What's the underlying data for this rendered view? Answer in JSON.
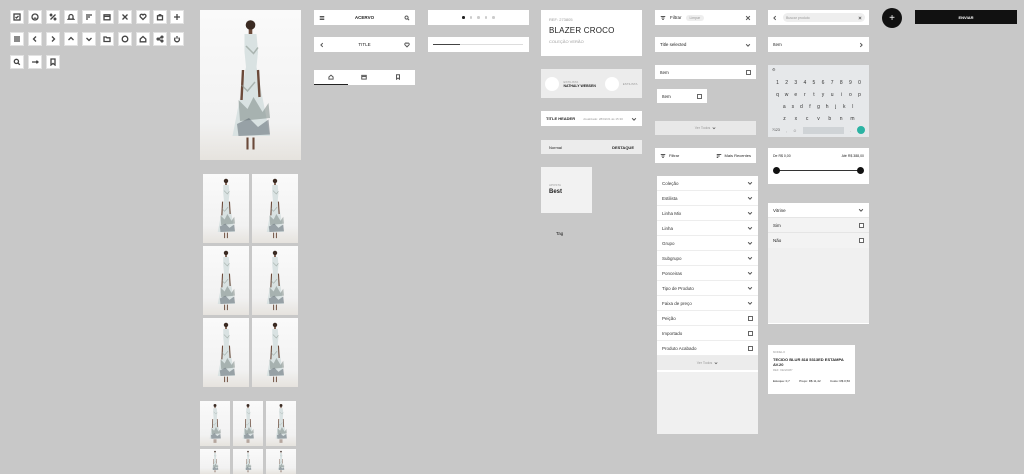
{
  "header": {
    "search_label": "ACERVO",
    "title": "TITLE"
  },
  "tabs": [
    "home",
    "calendar",
    "bookmark"
  ],
  "pagination": {
    "count": 5,
    "active": 0,
    "progress": 0.3
  },
  "product": {
    "ref": "REF: 273805",
    "name": "BLAZER CROCO",
    "collection": "COLEÇÃO VERÃO"
  },
  "designers": [
    {
      "label": "ESTILISTA",
      "name": "NATHALY WEBSEN"
    },
    {
      "label": "ESTILISTA",
      "name": ""
    }
  ],
  "title_header": {
    "label": "TITLE HEADER",
    "updated": "Atualizado: 28/02/21 às 15:30"
  },
  "toggle": {
    "left": "Normal",
    "right": "DESTAQUE"
  },
  "highlight": {
    "label": "APOSTA",
    "value": "Best"
  },
  "tag": "Tag",
  "filter_chip": {
    "label": "Filtrar",
    "chip": "Limpar"
  },
  "select": {
    "value": "Title selected"
  },
  "item_list": {
    "item_label": "Item",
    "item2_label": "Item",
    "see_all": "Ver Todos"
  },
  "sortbar": {
    "filter": "Filtrar",
    "sort": "Mais Recentes"
  },
  "filters": [
    {
      "label": "Coleção",
      "type": "chevron"
    },
    {
      "label": "Estilista",
      "type": "chevron"
    },
    {
      "label": "Linha Mix",
      "type": "chevron"
    },
    {
      "label": "Linha",
      "type": "chevron"
    },
    {
      "label": "Grupo",
      "type": "chevron"
    },
    {
      "label": "Subgrupo",
      "type": "chevron"
    },
    {
      "label": "Ponceiras",
      "type": "chevron"
    },
    {
      "label": "Tipo de Produto",
      "type": "chevron"
    },
    {
      "label": "Faixa de preço",
      "type": "chevron"
    },
    {
      "label": "Peição",
      "type": "check"
    },
    {
      "label": "Importado",
      "type": "check"
    },
    {
      "label": "Produto Acabado",
      "type": "check"
    }
  ],
  "filters_see_all": "Ver Todos",
  "search": {
    "placeholder": "Buscar produto"
  },
  "item_dropdown": {
    "label": "Item"
  },
  "keyboard": {
    "row1": [
      "1",
      "2",
      "3",
      "4",
      "5",
      "6",
      "7",
      "8",
      "9",
      "0"
    ],
    "row2": [
      "q",
      "w",
      "e",
      "r",
      "t",
      "y",
      "u",
      "i",
      "o",
      "p"
    ],
    "row3": [
      "a",
      "s",
      "d",
      "f",
      "g",
      "h",
      "j",
      "k",
      "l"
    ],
    "row4": [
      "z",
      "x",
      "c",
      "v",
      "b",
      "n",
      "m"
    ],
    "sym": "?123"
  },
  "range": {
    "min_label": "De R$ 0,00",
    "max_label": "Até R$ 388,00"
  },
  "vitrine": {
    "label": "Vitrine",
    "options": [
      "Sim",
      "Não"
    ]
  },
  "fab": {
    "label": "+"
  },
  "cta": {
    "label": "ENVIAR"
  },
  "fabric": {
    "kicker": "MODELO",
    "title": "TECIDO BLUR 818 5313ED ESTAMPA AV.20",
    "sub": "REF: 99220387",
    "stats": [
      "Estoque: 0,7",
      "Preço: R$ 11,42",
      "Custo: R$ 0,50"
    ]
  }
}
